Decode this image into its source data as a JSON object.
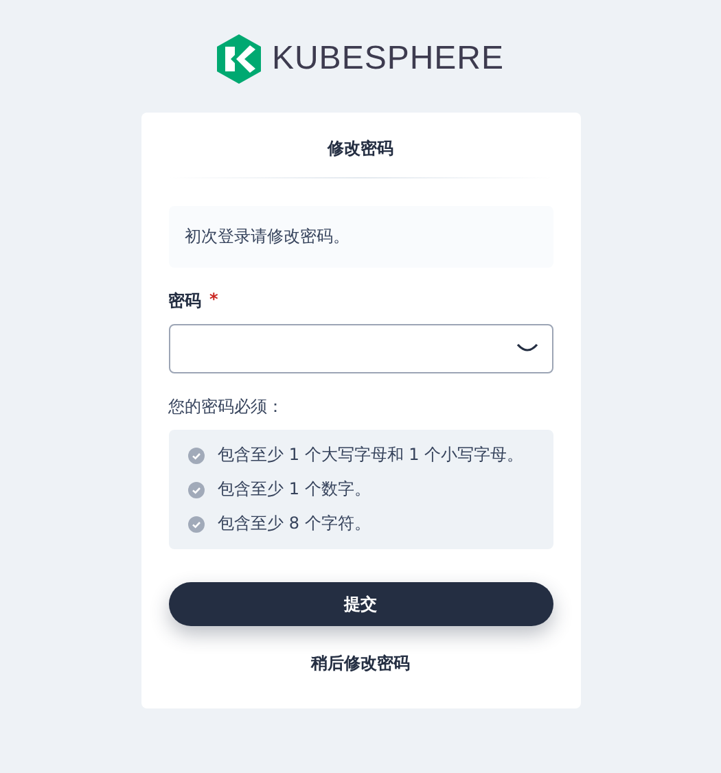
{
  "logo": {
    "text": "KUBESPHERE"
  },
  "card": {
    "title": "修改密码",
    "notice": "初次登录请修改密码。",
    "field": {
      "label": "密码",
      "required_mark": "*"
    },
    "rules_title": "您的密码必须：",
    "rules": [
      {
        "text": "包含至少 1 个大写字母和 1 个小写字母。",
        "met": false
      },
      {
        "text": "包含至少 1 个数字。",
        "met": false
      },
      {
        "text": "包含至少 8 个字符。",
        "met": false
      }
    ],
    "submit": "提交",
    "later": "稍后修改密码"
  }
}
